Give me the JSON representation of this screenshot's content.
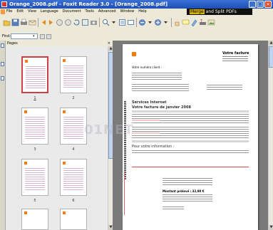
{
  "window": {
    "title": "Orange_2008.pdf - Foxit Reader 3.0 - [Orange_2008.pdf]"
  },
  "menu": {
    "items": [
      "File",
      "Edit",
      "View",
      "Language",
      "Document",
      "Tools",
      "Advanced",
      "Window",
      "Help"
    ]
  },
  "promo": {
    "highlight": "Merge",
    "text": "and Split PDFs"
  },
  "find": {
    "label": "Find:",
    "value": ""
  },
  "sidebar": {
    "header": "Pages",
    "close": "×"
  },
  "thumbnails": {
    "labels": [
      "1",
      "2",
      "3",
      "4",
      "5",
      "6"
    ],
    "selected": "1"
  },
  "document": {
    "title": "Votre facture",
    "client_label": "Votre numéro client :",
    "section_services": "Services Internet",
    "section_summary": "Votre facture de janvier 2008",
    "section_info": "Pour votre information :",
    "coupon_total": "Montant prélevé : 32,90 €"
  },
  "watermark": "01NET",
  "colors": {
    "titlebar": "#1e4fb0",
    "brand_orange": "#ff7900",
    "selection": "#d04040",
    "promo_bg": "#101010"
  }
}
